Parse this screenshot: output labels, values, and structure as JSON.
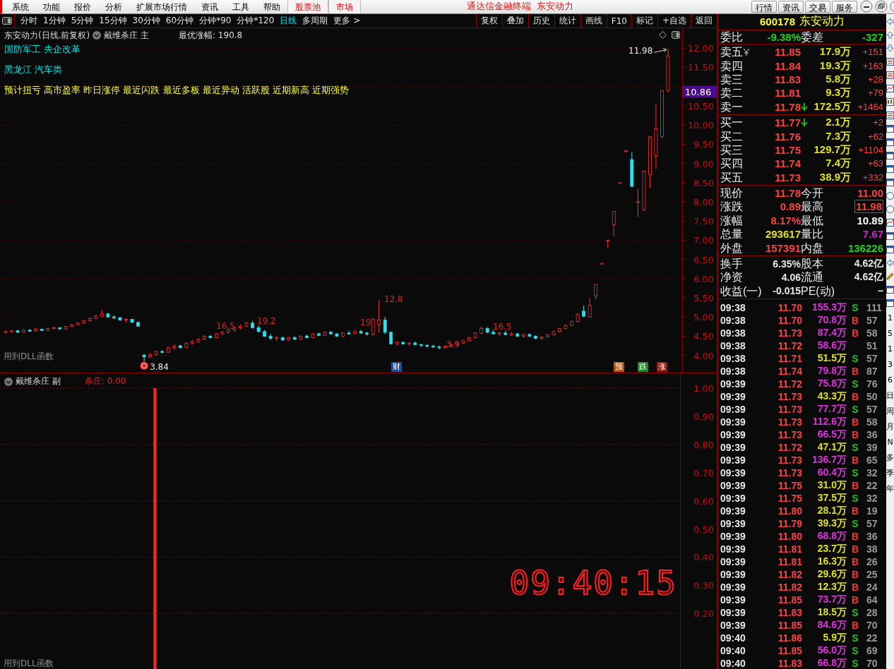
{
  "menu": {
    "items": [
      {
        "label": "系统"
      },
      {
        "label": "功能"
      },
      {
        "label": "报价"
      },
      {
        "label": "分析"
      },
      {
        "label": "扩展市场行情"
      },
      {
        "label": "资讯"
      },
      {
        "label": "工具"
      },
      {
        "label": "帮助"
      },
      {
        "label": "股票池",
        "kind": "highlight"
      },
      {
        "label": "市场",
        "kind": "highlight"
      }
    ],
    "title": "通达信金融终端  东安动力",
    "buttons": [
      "行情",
      "资讯",
      "交易",
      "服务"
    ]
  },
  "periods": [
    {
      "label": "分时",
      "selected": false
    },
    {
      "label": "1分钟",
      "selected": false
    },
    {
      "label": "5分钟",
      "selected": false
    },
    {
      "label": "15分钟",
      "selected": false
    },
    {
      "label": "30分钟",
      "selected": false
    },
    {
      "label": "60分钟",
      "selected": false
    },
    {
      "label": "分钟*90",
      "selected": false
    },
    {
      "label": "分钟*120",
      "selected": false
    },
    {
      "label": "日线",
      "selected": true
    },
    {
      "label": "多周期",
      "selected": false
    },
    {
      "label": "更多 >",
      "selected": false
    }
  ],
  "chart_tools": [
    "复权",
    "叠加",
    "历史",
    "统计",
    "画线",
    "F10",
    "标记",
    "+自选",
    "返回"
  ],
  "main_chart": {
    "stock": "东安动力(日线.前复权)",
    "indicator": "戴维杀庄 主",
    "best_gain": "最优涨幅: 190.8",
    "tag_lines": [
      {
        "text": "国防军工 央企改革",
        "color": "#00e0e0"
      },
      {
        "text": "黑龙江  汽车类",
        "color": "#00e0e0"
      },
      {
        "text": "预计扭亏 高市盈率 昨日涨停 最近闪跌 最近多板 最近异动 活跃股 近期新高 近期强势",
        "color": "#ffff33"
      }
    ],
    "labels": [
      {
        "text": "16.5",
        "kind": "indicator"
      },
      {
        "text": "19.2",
        "kind": "indicator"
      },
      {
        "text": "19",
        "kind": "indicator"
      },
      {
        "text": "12.8",
        "kind": "indicator"
      },
      {
        "text": "3.9",
        "kind": "indicator"
      },
      {
        "text": "16.5",
        "kind": "indicator"
      },
      {
        "text": "11.98",
        "kind": "high"
      },
      {
        "text": "3.84",
        "kind": "low"
      }
    ],
    "signals": [
      {
        "text": "财",
        "color": "#1f4e9c"
      },
      {
        "text": "预",
        "color": "#b8520a"
      },
      {
        "text": "跌",
        "color": "#1d8a1d"
      },
      {
        "text": "涨",
        "color": "#8a1a10"
      }
    ],
    "footnote": "用到DLL函数",
    "current_price": "10.86",
    "chart_data": {
      "type": "candlestick",
      "grid": true,
      "ylim": [
        3.55,
        12.52
      ],
      "yticks": [
        {
          "value": 12,
          "label": "12.00"
        },
        {
          "value": 11.5,
          "label": "11.50"
        },
        {
          "value": 10.5,
          "label": "10.50"
        },
        {
          "value": 10,
          "label": "10.00"
        },
        {
          "value": 9.5,
          "label": "9.50"
        },
        {
          "value": 9,
          "label": "9.00"
        },
        {
          "value": 8.5,
          "label": "8.50"
        },
        {
          "value": 8,
          "label": "8.00"
        },
        {
          "value": 7.5,
          "label": "7.50"
        },
        {
          "value": 7,
          "label": "7.00"
        },
        {
          "value": 6.5,
          "label": "6.50"
        },
        {
          "value": 6,
          "label": "6.00"
        },
        {
          "value": 5.5,
          "label": "5.50"
        },
        {
          "value": 5,
          "label": "5.00"
        },
        {
          "value": 4.5,
          "label": "4.50"
        },
        {
          "value": 4,
          "label": "4.00"
        }
      ],
      "ohlc": [
        [
          4.6,
          4.65,
          4.57,
          4.62
        ],
        [
          4.62,
          4.66,
          4.6,
          4.64
        ],
        [
          4.64,
          4.66,
          4.58,
          4.6
        ],
        [
          4.6,
          4.68,
          4.59,
          4.66
        ],
        [
          4.66,
          4.67,
          4.61,
          4.63
        ],
        [
          4.63,
          4.7,
          4.62,
          4.68
        ],
        [
          4.68,
          4.69,
          4.63,
          4.65
        ],
        [
          4.65,
          4.72,
          4.64,
          4.7
        ],
        [
          4.7,
          4.75,
          4.68,
          4.72
        ],
        [
          4.72,
          4.73,
          4.66,
          4.69
        ],
        [
          4.69,
          4.77,
          4.68,
          4.75
        ],
        [
          4.75,
          4.82,
          4.73,
          4.8
        ],
        [
          4.8,
          4.86,
          4.78,
          4.84
        ],
        [
          4.84,
          4.92,
          4.82,
          4.9
        ],
        [
          4.9,
          4.98,
          4.88,
          4.96
        ],
        [
          4.96,
          5.06,
          4.94,
          5.02
        ],
        [
          5.02,
          5.18,
          5.0,
          5.08
        ],
        [
          5.08,
          5.1,
          4.98,
          5.0
        ],
        [
          5.0,
          5.04,
          4.94,
          4.98
        ],
        [
          4.98,
          5.0,
          4.9,
          4.92
        ],
        [
          4.92,
          4.96,
          4.86,
          4.94
        ],
        [
          4.94,
          4.95,
          4.84,
          4.86
        ],
        [
          4.86,
          4.88,
          4.74,
          4.76
        ],
        [
          4.0,
          4.05,
          3.84,
          3.96
        ],
        [
          3.96,
          4.06,
          3.92,
          4.02
        ],
        [
          4.02,
          4.12,
          4.0,
          4.1
        ],
        [
          4.1,
          4.14,
          4.05,
          4.08
        ],
        [
          4.08,
          4.22,
          4.06,
          4.2
        ],
        [
          4.2,
          4.28,
          4.16,
          4.25
        ],
        [
          4.25,
          4.27,
          4.18,
          4.2
        ],
        [
          4.2,
          4.34,
          4.19,
          4.32
        ],
        [
          4.32,
          4.4,
          4.28,
          4.36
        ],
        [
          4.36,
          4.45,
          4.33,
          4.42
        ],
        [
          4.42,
          4.52,
          4.4,
          4.5
        ],
        [
          4.5,
          4.53,
          4.44,
          4.46
        ],
        [
          4.46,
          4.58,
          4.45,
          4.56
        ],
        [
          4.56,
          4.64,
          4.52,
          4.6
        ],
        [
          4.6,
          4.7,
          4.57,
          4.66
        ],
        [
          4.66,
          4.74,
          4.62,
          4.72
        ],
        [
          4.72,
          4.8,
          4.68,
          4.76
        ],
        [
          4.76,
          4.88,
          4.74,
          4.84
        ],
        [
          4.84,
          4.9,
          4.7,
          4.72
        ],
        [
          4.72,
          4.78,
          4.6,
          4.62
        ],
        [
          4.62,
          4.66,
          4.48,
          4.5
        ],
        [
          4.5,
          4.56,
          4.4,
          4.44
        ],
        [
          4.44,
          4.5,
          4.36,
          4.46
        ],
        [
          4.46,
          4.48,
          4.38,
          4.4
        ],
        [
          4.4,
          4.48,
          4.38,
          4.46
        ],
        [
          4.46,
          4.5,
          4.4,
          4.42
        ],
        [
          4.42,
          4.52,
          4.41,
          4.5
        ],
        [
          4.5,
          4.54,
          4.44,
          4.46
        ],
        [
          4.46,
          4.58,
          4.45,
          4.56
        ],
        [
          4.56,
          4.6,
          4.5,
          4.52
        ],
        [
          4.52,
          4.62,
          4.5,
          4.6
        ],
        [
          4.6,
          4.64,
          4.54,
          4.56
        ],
        [
          4.56,
          4.58,
          4.48,
          4.5
        ],
        [
          4.5,
          4.6,
          4.48,
          4.58
        ],
        [
          4.58,
          4.64,
          4.54,
          4.56
        ],
        [
          4.56,
          4.66,
          4.55,
          4.62
        ],
        [
          4.62,
          4.66,
          4.56,
          4.58
        ],
        [
          4.58,
          4.62,
          4.5,
          4.55
        ],
        [
          4.55,
          4.95,
          4.5,
          4.95
        ],
        [
          4.8,
          5.45,
          4.6,
          4.92
        ],
        [
          4.92,
          5.0,
          4.55,
          4.6
        ],
        [
          4.6,
          4.62,
          4.28,
          4.3
        ],
        [
          4.3,
          4.36,
          4.26,
          4.34
        ],
        [
          4.34,
          4.36,
          4.28,
          4.3
        ],
        [
          4.3,
          4.34,
          4.24,
          4.32
        ],
        [
          4.32,
          4.36,
          4.26,
          4.28
        ],
        [
          4.28,
          4.3,
          4.22,
          4.26
        ],
        [
          4.26,
          4.3,
          4.2,
          4.24
        ],
        [
          4.24,
          4.28,
          4.18,
          4.22
        ],
        [
          4.22,
          4.26,
          4.16,
          4.2
        ],
        [
          4.2,
          4.26,
          4.18,
          4.24
        ],
        [
          4.24,
          4.3,
          4.22,
          4.28
        ],
        [
          4.28,
          4.34,
          4.26,
          4.32
        ],
        [
          4.32,
          4.4,
          4.3,
          4.38
        ],
        [
          4.38,
          4.48,
          4.36,
          4.46
        ],
        [
          4.46,
          4.6,
          4.44,
          4.58
        ],
        [
          4.58,
          4.76,
          4.55,
          4.7
        ],
        [
          4.7,
          4.74,
          4.58,
          4.6
        ],
        [
          4.6,
          4.66,
          4.54,
          4.56
        ],
        [
          4.56,
          4.62,
          4.5,
          4.58
        ],
        [
          4.58,
          4.64,
          4.52,
          4.54
        ],
        [
          4.54,
          4.6,
          4.5,
          4.56
        ],
        [
          4.56,
          4.58,
          4.48,
          4.5
        ],
        [
          4.5,
          4.56,
          4.46,
          4.54
        ],
        [
          4.54,
          4.58,
          4.48,
          4.5
        ],
        [
          4.5,
          4.52,
          4.42,
          4.44
        ],
        [
          4.44,
          4.5,
          4.4,
          4.48
        ],
        [
          4.48,
          4.56,
          4.46,
          4.54
        ],
        [
          4.54,
          4.64,
          4.52,
          4.62
        ],
        [
          4.62,
          4.72,
          4.6,
          4.7
        ],
        [
          4.7,
          4.8,
          4.68,
          4.78
        ],
        [
          4.78,
          4.9,
          4.76,
          4.88
        ],
        [
          4.88,
          5.1,
          4.86,
          5.06
        ],
        [
          5.15,
          5.3,
          5.0,
          5.02
        ],
        [
          5.0,
          5.5,
          4.98,
          5.3
        ],
        [
          5.55,
          5.85,
          5.45,
          5.85
        ],
        [
          6.4,
          6.4,
          6.4,
          6.4
        ],
        [
          7.0,
          7.0,
          6.8,
          7.0
        ],
        [
          7.4,
          7.75,
          7.1,
          7.75
        ],
        [
          8.5,
          8.5,
          8.5,
          8.5
        ],
        [
          9.33,
          9.33,
          9.3,
          9.33
        ],
        [
          9.1,
          9.3,
          8.4,
          8.4
        ],
        [
          8.0,
          8.35,
          7.6,
          8.0
        ],
        [
          7.8,
          8.8,
          7.75,
          8.8
        ],
        [
          8.7,
          9.7,
          8.35,
          9.7
        ],
        [
          9.2,
          10.55,
          8.85,
          9.9
        ],
        [
          9.7,
          10.9,
          9.65,
          10.9
        ],
        [
          10.9,
          11.98,
          10.85,
          11.8
        ]
      ]
    }
  },
  "sub_chart": {
    "indicator": "戴维杀庄 副",
    "value": "杀庄: 0.00",
    "axis": [
      "1.00",
      "0.90",
      "0.80",
      "0.70",
      "0.60",
      "0.50",
      "0.40",
      "0.30",
      "0.20"
    ],
    "clock": "09:40:15",
    "footnote": "用到DLL函数"
  },
  "quote": {
    "code": "600178",
    "name": "东安动力",
    "ratio_label": "委比",
    "ratio": "-9.38%",
    "diff_label": "委差",
    "diff": "-327",
    "asks": [
      {
        "label": "卖五",
        "yen": true,
        "price": "11.85",
        "arrow": false,
        "volume": "17.9万",
        "change": "+151"
      },
      {
        "label": "卖四",
        "yen": false,
        "price": "11.84",
        "arrow": false,
        "volume": "19.3万",
        "change": "+163"
      },
      {
        "label": "卖三",
        "yen": false,
        "price": "11.83",
        "arrow": false,
        "volume": "5.8万",
        "change": "+28"
      },
      {
        "label": "卖二",
        "yen": false,
        "price": "11.81",
        "arrow": false,
        "volume": "9.3万",
        "change": "+79"
      },
      {
        "label": "卖一",
        "yen": false,
        "price": "11.78",
        "arrow": true,
        "volume": "172.5万",
        "change": "+1464"
      }
    ],
    "bids": [
      {
        "label": "买一",
        "yen": false,
        "price": "11.77",
        "arrow": true,
        "volume": "2.1万",
        "change": "+2"
      },
      {
        "label": "买二",
        "yen": false,
        "price": "11.76",
        "arrow": false,
        "volume": "7.3万",
        "change": "+62"
      },
      {
        "label": "买三",
        "yen": false,
        "price": "11.75",
        "arrow": false,
        "volume": "129.7万",
        "change": "+1104"
      },
      {
        "label": "买四",
        "yen": false,
        "price": "11.74",
        "arrow": false,
        "volume": "7.4万",
        "change": "+63"
      },
      {
        "label": "买五",
        "yen": false,
        "price": "11.73",
        "arrow": false,
        "volume": "38.9万",
        "change": "+332"
      }
    ],
    "stats": [
      {
        "label": "现价",
        "value": {
          "text": "11.78",
          "color": "#ff4040"
        },
        "label2": "今开",
        "value2": {
          "text": "11.00",
          "color": "#ff4040"
        },
        "boxed": false
      },
      {
        "label": "涨跌",
        "value": {
          "text": "0.89",
          "color": "#ff4040"
        },
        "label2": "最高",
        "value2": {
          "text": "11.98",
          "color": "#ff4040"
        },
        "boxed": true
      },
      {
        "label": "涨幅",
        "value": {
          "text": "8.17%",
          "color": "#ff4040"
        },
        "label2": "最低",
        "value2": {
          "text": "10.89",
          "color": "#ffffff"
        },
        "boxed": false
      },
      {
        "label": "总量",
        "value": {
          "text": "293617",
          "color": "#e0e020"
        },
        "label2": "量比",
        "value2": {
          "text": "7.67",
          "color": "#d020d0"
        },
        "boxed": false
      },
      {
        "label": "外盘",
        "value": {
          "text": "157391",
          "color": "#ff4040"
        },
        "label2": "内盘",
        "value2": {
          "text": "136226",
          "color": "#20d020"
        },
        "boxed": false
      }
    ],
    "finance": [
      {
        "label": "换手",
        "value": "6.35%",
        "label2": "股本",
        "value2": "4.62亿"
      },
      {
        "label": "净资",
        "value": "4.06",
        "label2": "流通",
        "value2": "4.62亿"
      },
      {
        "label": "收益(一)",
        "value": "-0.015",
        "label2": "PE(动)",
        "value2": "−"
      }
    ],
    "ticks": [
      {
        "time": "09:38",
        "price": "11.70",
        "volume": {
          "text": "155.3万",
          "color": "#e030e0"
        },
        "side": {
          "text": "S",
          "color": "#20c020"
        },
        "count": "111"
      },
      {
        "time": "09:38",
        "price": "11.70",
        "volume": {
          "text": "70.8万",
          "color": "#e030e0"
        },
        "side": {
          "text": "B",
          "color": "#ff3030"
        },
        "count": "57"
      },
      {
        "time": "09:38",
        "price": "11.73",
        "volume": {
          "text": "87.4万",
          "color": "#e030e0"
        },
        "side": {
          "text": "B",
          "color": "#ff3030"
        },
        "count": "58"
      },
      {
        "time": "09:38",
        "price": "11.72",
        "volume": {
          "text": "58.6万",
          "color": "#e030e0"
        },
        "count": "51"
      },
      {
        "time": "09:38",
        "price": "11.71",
        "volume": {
          "text": "51.5万",
          "color": "#e0e020"
        },
        "side": {
          "text": "S",
          "color": "#20c020"
        },
        "count": "57"
      },
      {
        "time": "09:38",
        "price": "11.74",
        "volume": {
          "text": "79.8万",
          "color": "#e030e0"
        },
        "side": {
          "text": "B",
          "color": "#ff3030"
        },
        "count": "87"
      },
      {
        "time": "09:39",
        "price": "11.72",
        "volume": {
          "text": "75.8万",
          "color": "#e030e0"
        },
        "side": {
          "text": "S",
          "color": "#20c020"
        },
        "count": "76"
      },
      {
        "time": "09:39",
        "price": "11.73",
        "volume": {
          "text": "43.3万",
          "color": "#e0e020"
        },
        "side": {
          "text": "B",
          "color": "#ff3030"
        },
        "count": "50"
      },
      {
        "time": "09:39",
        "price": "11.73",
        "volume": {
          "text": "77.7万",
          "color": "#e030e0"
        },
        "side": {
          "text": "S",
          "color": "#20c020"
        },
        "count": "57"
      },
      {
        "time": "09:39",
        "price": "11.73",
        "volume": {
          "text": "112.6万",
          "color": "#e030e0"
        },
        "side": {
          "text": "B",
          "color": "#ff3030"
        },
        "count": "58"
      },
      {
        "time": "09:39",
        "price": "11.73",
        "volume": {
          "text": "66.5万",
          "color": "#e030e0"
        },
        "side": {
          "text": "B",
          "color": "#ff3030"
        },
        "count": "36"
      },
      {
        "time": "09:39",
        "price": "11.72",
        "volume": {
          "text": "47.1万",
          "color": "#e0e020"
        },
        "side": {
          "text": "S",
          "color": "#20c020"
        },
        "count": "39"
      },
      {
        "time": "09:39",
        "price": "11.73",
        "volume": {
          "text": "136.7万",
          "color": "#e030e0"
        },
        "side": {
          "text": "B",
          "color": "#ff3030"
        },
        "count": "65"
      },
      {
        "time": "09:39",
        "price": "11.73",
        "volume": {
          "text": "60.4万",
          "color": "#e030e0"
        },
        "side": {
          "text": "S",
          "color": "#20c020"
        },
        "count": "32"
      },
      {
        "time": "09:39",
        "price": "11.75",
        "volume": {
          "text": "31.0万",
          "color": "#e0e020"
        },
        "side": {
          "text": "B",
          "color": "#ff3030"
        },
        "count": "22"
      },
      {
        "time": "09:39",
        "price": "11.75",
        "volume": {
          "text": "37.5万",
          "color": "#e0e020"
        },
        "side": {
          "text": "S",
          "color": "#20c020"
        },
        "count": "32"
      },
      {
        "time": "09:39",
        "price": "11.80",
        "volume": {
          "text": "28.1万",
          "color": "#e0e020"
        },
        "side": {
          "text": "B",
          "color": "#ff3030"
        },
        "count": "19"
      },
      {
        "time": "09:39",
        "price": "11.79",
        "volume": {
          "text": "39.3万",
          "color": "#e0e020"
        },
        "side": {
          "text": "S",
          "color": "#20c020"
        },
        "count": "57"
      },
      {
        "time": "09:39",
        "price": "11.80",
        "volume": {
          "text": "68.8万",
          "color": "#e030e0"
        },
        "side": {
          "text": "B",
          "color": "#ff3030"
        },
        "count": "36"
      },
      {
        "time": "09:39",
        "price": "11.81",
        "volume": {
          "text": "23.7万",
          "color": "#e0e020"
        },
        "side": {
          "text": "B",
          "color": "#ff3030"
        },
        "count": "38"
      },
      {
        "time": "09:39",
        "price": "11.81",
        "volume": {
          "text": "16.3万",
          "color": "#e0e020"
        },
        "side": {
          "text": "B",
          "color": "#ff3030"
        },
        "count": "26"
      },
      {
        "time": "09:39",
        "price": "11.82",
        "volume": {
          "text": "29.6万",
          "color": "#e0e020"
        },
        "side": {
          "text": "B",
          "color": "#ff3030"
        },
        "count": "25"
      },
      {
        "time": "09:39",
        "price": "11.82",
        "volume": {
          "text": "12.3万",
          "color": "#e0e020"
        },
        "side": {
          "text": "B",
          "color": "#ff3030"
        },
        "count": "24"
      },
      {
        "time": "09:39",
        "price": "11.85",
        "volume": {
          "text": "73.7万",
          "color": "#e030e0"
        },
        "side": {
          "text": "B",
          "color": "#ff3030"
        },
        "count": "64"
      },
      {
        "time": "09:39",
        "price": "11.83",
        "volume": {
          "text": "18.5万",
          "color": "#e0e020"
        },
        "side": {
          "text": "S",
          "color": "#20c020"
        },
        "count": "28"
      },
      {
        "time": "09:39",
        "price": "11.85",
        "volume": {
          "text": "84.6万",
          "color": "#e030e0"
        },
        "side": {
          "text": "B",
          "color": "#ff3030"
        },
        "count": "70"
      },
      {
        "time": "09:40",
        "price": "11.86",
        "volume": {
          "text": "5.9万",
          "color": "#e0e020"
        },
        "side": {
          "text": "S",
          "color": "#20c020"
        },
        "count": "22"
      },
      {
        "time": "09:40",
        "price": "11.85",
        "volume": {
          "text": "56.0万",
          "color": "#e030e0"
        },
        "side": {
          "text": "S",
          "color": "#20c020"
        },
        "count": "69"
      },
      {
        "time": "09:40",
        "price": "11.83",
        "volume": {
          "text": "66.8万",
          "color": "#e030e0"
        },
        "side": {
          "text": "S",
          "color": "#20c020"
        },
        "count": "70"
      }
    ]
  },
  "toolbar": [
    {
      "kind": "arrow-left"
    },
    {
      "kind": "arrow-up"
    },
    {
      "kind": "arrow-down"
    },
    {
      "kind": "table"
    },
    {
      "kind": "table"
    },
    {
      "kind": "chart"
    },
    {
      "kind": "candle"
    },
    {
      "kind": "table"
    },
    {
      "kind": "window"
    },
    {
      "kind": "window"
    },
    {
      "kind": "window"
    },
    {
      "kind": "window"
    },
    {
      "kind": "window"
    },
    {
      "kind": "circle"
    },
    {
      "kind": "circle"
    },
    {
      "kind": "chart"
    },
    {
      "kind": "window"
    },
    {
      "kind": "window"
    },
    {
      "kind": "arrow-left"
    },
    {
      "kind": "pencil"
    },
    {
      "kind": "window"
    },
    {
      "kind": "window"
    },
    {
      "kind": "text",
      "text": "1"
    },
    {
      "kind": "text",
      "text": "5"
    },
    {
      "kind": "text",
      "text": "1"
    },
    {
      "kind": "text",
      "text": "3"
    },
    {
      "kind": "text",
      "text": "6"
    },
    {
      "kind": "text",
      "text": "日"
    },
    {
      "kind": "text",
      "text": "周"
    },
    {
      "kind": "text",
      "text": "月"
    },
    {
      "kind": "text",
      "text": "N"
    },
    {
      "kind": "text",
      "text": "多"
    },
    {
      "kind": "text",
      "text": "季"
    },
    {
      "kind": "text",
      "text": "年"
    }
  ]
}
